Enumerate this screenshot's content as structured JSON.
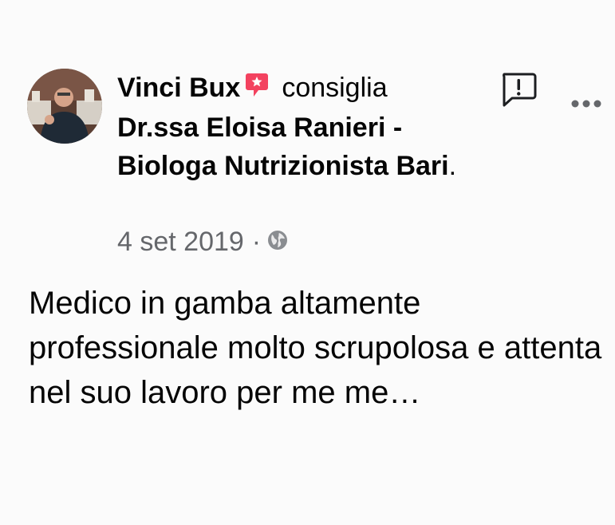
{
  "post": {
    "author": "Vinci Bux",
    "verb": "consiglia",
    "page_name": "Dr.ssa Eloisa Ranieri - Biologa Nutrizionista Bari",
    "page_suffix": ".",
    "date": "4 set 2019",
    "separator": "·",
    "review_text": "Medico in gamba altamente professionale molto scrupolosa e attenta nel suo lavoro per me me…"
  },
  "icons": {
    "badge": "recommend-badge-icon",
    "privacy": "globe-icon",
    "report": "report-icon",
    "more": "more-options-icon"
  },
  "colors": {
    "badge": "#f3425f",
    "meta_text": "#65676b",
    "text": "#050505",
    "background": "#fbfbfb"
  }
}
